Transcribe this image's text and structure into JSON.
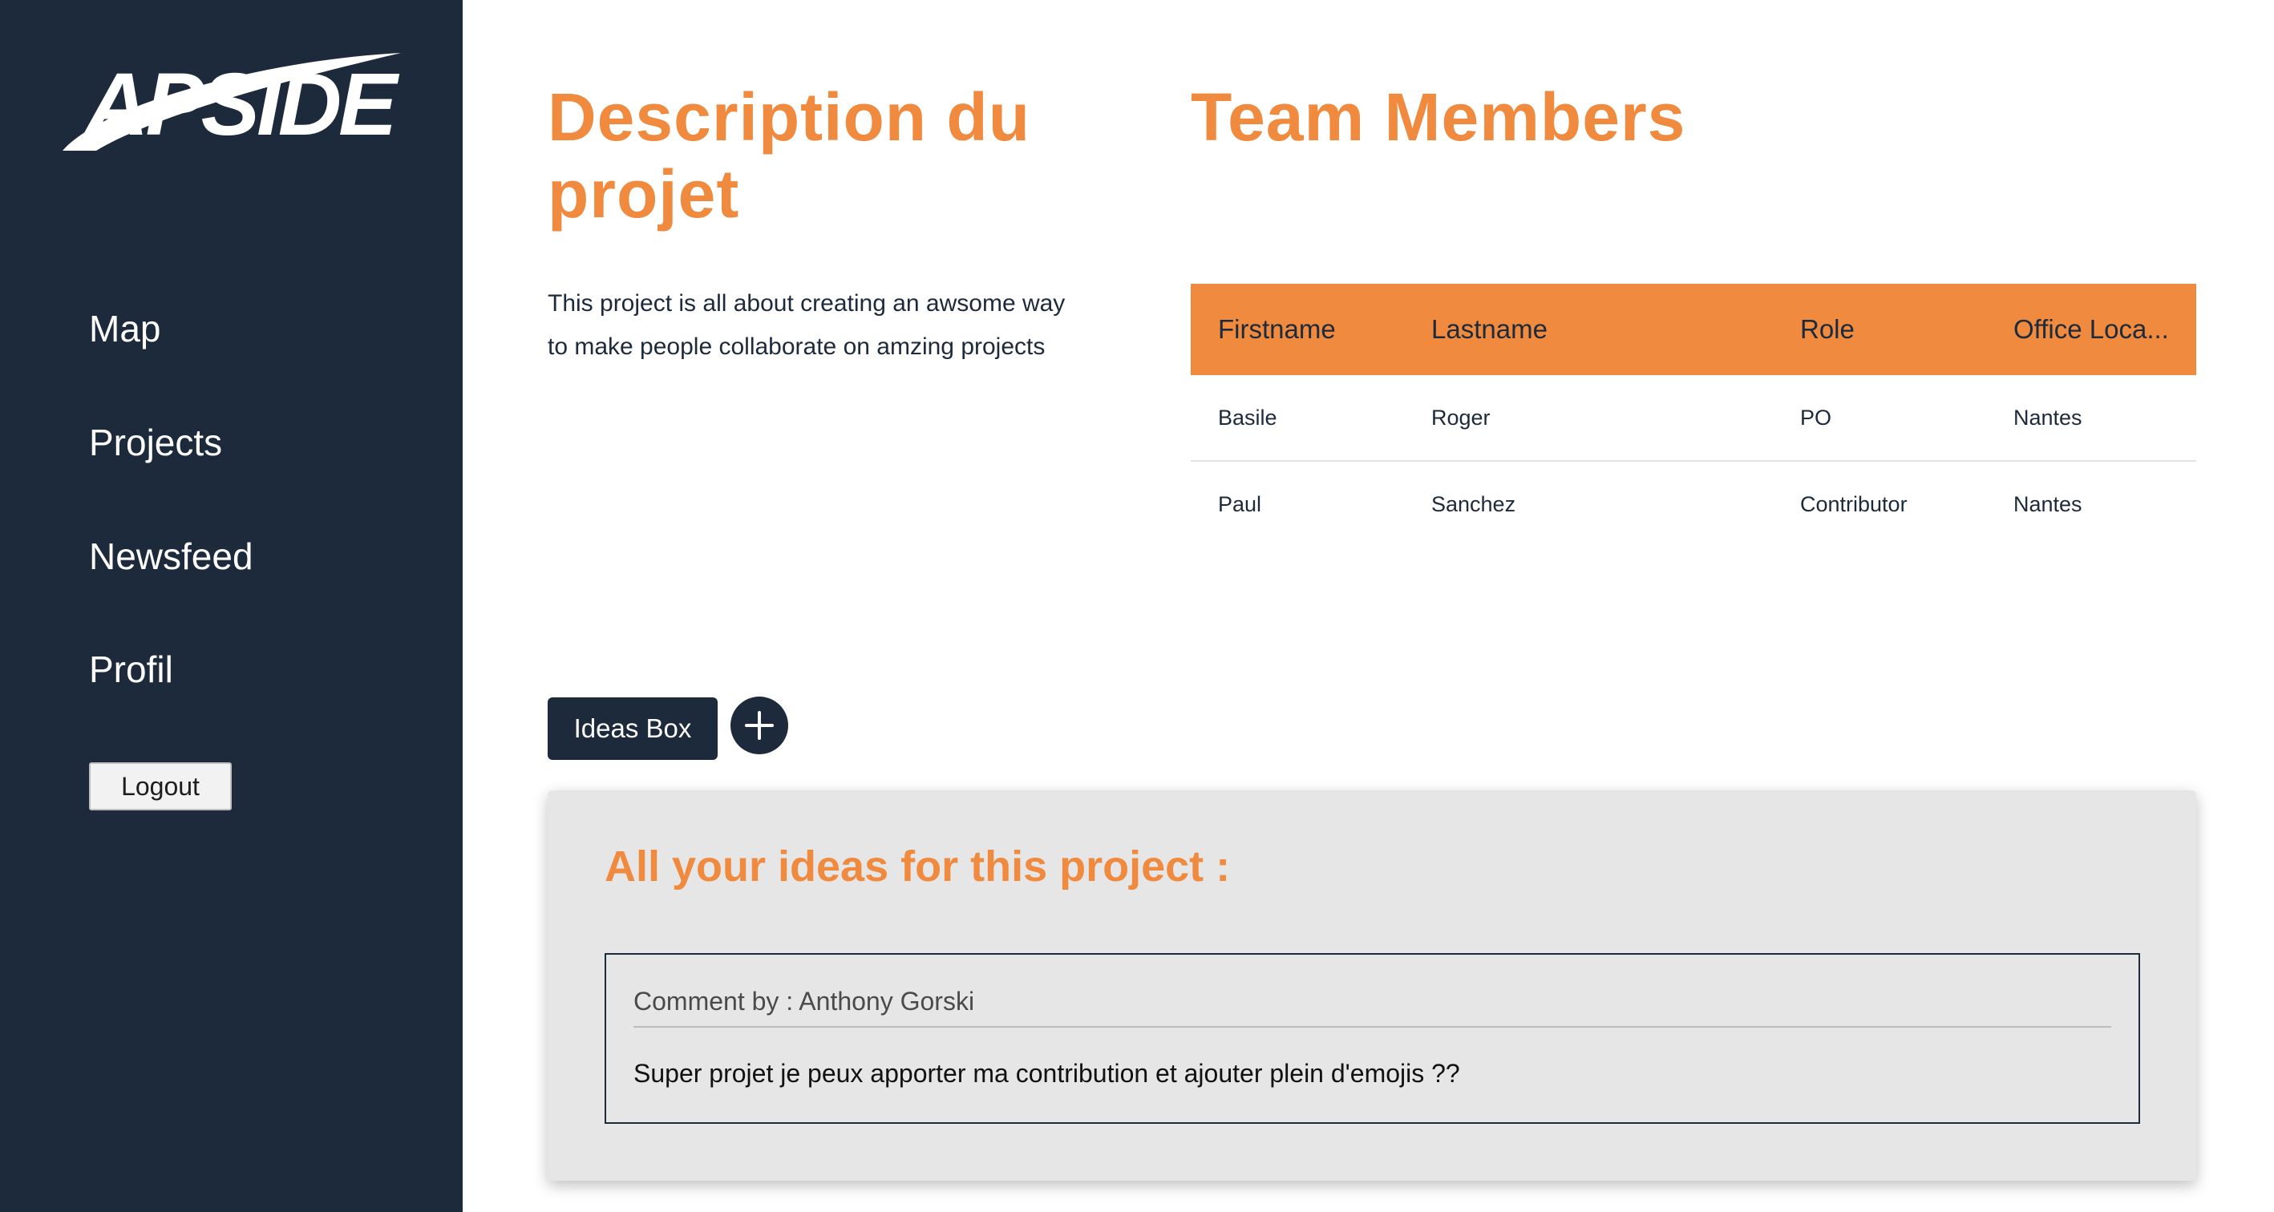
{
  "brand": {
    "logo_text": "APSIDE",
    "logo_color": "#ffffff"
  },
  "colors": {
    "sidebar_bg": "#1d2a3b",
    "accent": "#ef8a3e",
    "panel_bg": "#e6e6e6"
  },
  "sidebar": {
    "items": [
      {
        "label": "Map"
      },
      {
        "label": "Projects"
      },
      {
        "label": "Newsfeed"
      },
      {
        "label": "Profil"
      }
    ],
    "logout_label": "Logout"
  },
  "description": {
    "title": "Description du projet",
    "text": "This project is all about creating an awsome way to make people collaborate on amzing projects"
  },
  "team": {
    "title": "Team Members",
    "columns": [
      "Firstname",
      "Lastname",
      "Role",
      "Office Loca..."
    ],
    "rows": [
      [
        "Basile",
        "Roger",
        "PO",
        "Nantes"
      ],
      [
        "Paul",
        "Sanchez",
        "Contributor",
        "Nantes"
      ]
    ]
  },
  "ideas": {
    "button_label": "Ideas Box",
    "add_icon": "plus-icon",
    "panel_title": "All your ideas for this project :",
    "comments": [
      {
        "author": "Comment by : Anthony Gorski",
        "text": "Super projet je peux apporter ma contribution et ajouter plein d'emojis ??"
      }
    ]
  }
}
